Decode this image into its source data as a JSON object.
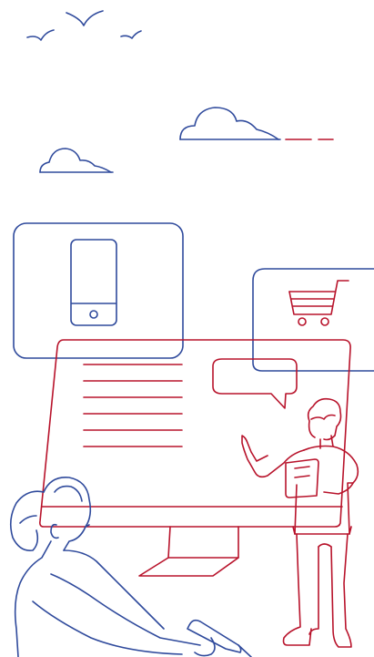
{
  "illustration": {
    "colors": {
      "blue": "#2F4A9C",
      "red": "#B8132B",
      "background": "#FFFFFF"
    },
    "elements": {
      "birds": "bird-icon",
      "clouds": "cloud-icon",
      "phone": "smartphone-icon",
      "cart": "shopping-cart-icon",
      "speech": "speech-bubble-icon",
      "monitor": "monitor-screen",
      "presenter": "man-with-clipboard",
      "seated_person": "woman-with-pen"
    }
  }
}
